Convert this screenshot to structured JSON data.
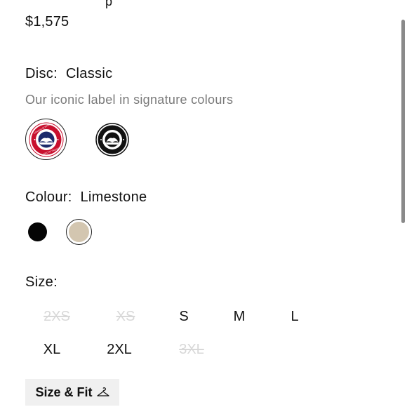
{
  "cut_text": "p",
  "price": "$1,575",
  "disc": {
    "label": "Disc:",
    "value": "Classic",
    "description": "Our iconic label in signature colours",
    "options": [
      {
        "icon": "canada-goose-classic-disc-icon",
        "selected": true
      },
      {
        "icon": "canada-goose-black-disc-icon",
        "selected": false
      }
    ]
  },
  "colour": {
    "label": "Colour:",
    "value": "Limestone",
    "options": [
      {
        "color": "#050505",
        "selected": false
      },
      {
        "color": "#d3c6b0",
        "selected": true
      }
    ]
  },
  "size": {
    "label": "Size:",
    "options": [
      {
        "label": "2XS",
        "available": false
      },
      {
        "label": "XS",
        "available": false
      },
      {
        "label": "S",
        "available": true
      },
      {
        "label": "M",
        "available": true
      },
      {
        "label": "L",
        "available": true
      },
      {
        "label": "XL",
        "available": true
      },
      {
        "label": "2XL",
        "available": true
      },
      {
        "label": "3XL",
        "available": false
      }
    ]
  },
  "size_fit_button": {
    "label": "Size & Fit",
    "icon": "hanger-icon"
  }
}
